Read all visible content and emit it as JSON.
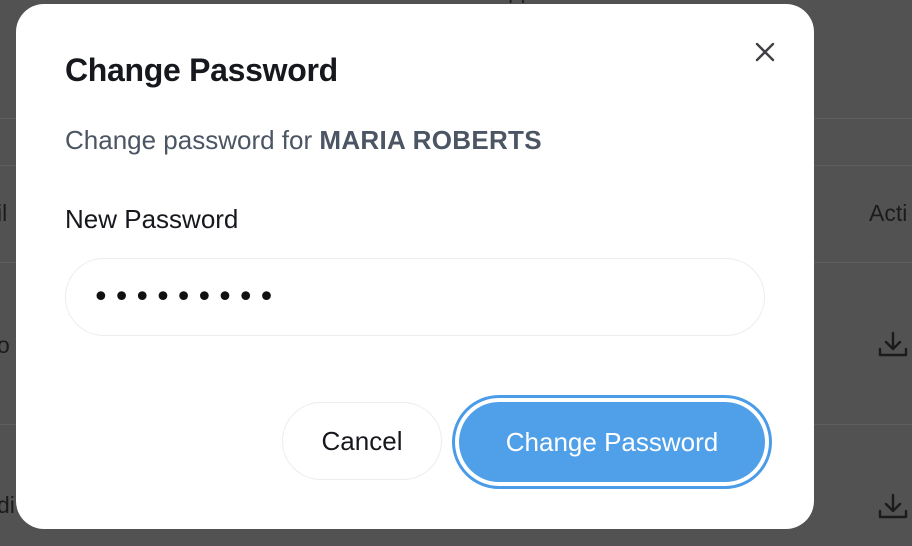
{
  "background": {
    "top_partial_text": "Fl",
    "left_partial_texts": [
      "il",
      "o",
      "di"
    ],
    "right_header_partial": "Acti",
    "row_icons": [
      "download-icon",
      "download-icon"
    ]
  },
  "modal": {
    "title": "Change Password",
    "close_icon": "close-icon",
    "subtitle_prefix": "Change password for ",
    "user_name": "MARIA ROBERTS",
    "field_label": "New Password",
    "password_value": "•••••••••",
    "cancel_label": "Cancel",
    "submit_label": "Change Password",
    "colors": {
      "primary": "#4f9fe9",
      "focus_ring": "#4a9be8",
      "title_text": "#16181d",
      "muted_text": "#4b5563"
    }
  }
}
